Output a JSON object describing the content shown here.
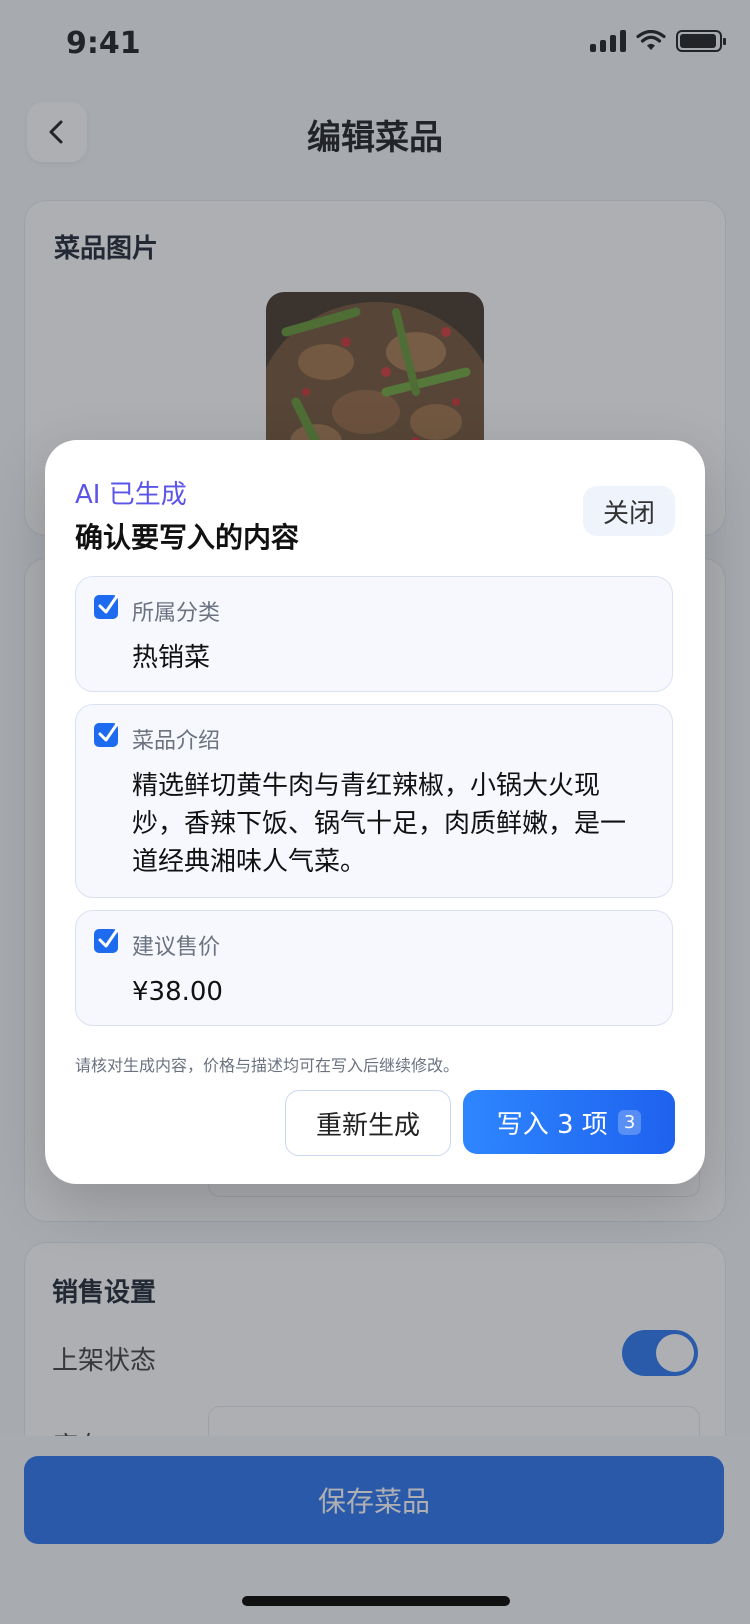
{
  "status": {
    "time": "9:41"
  },
  "header": {
    "title": "编辑菜品"
  },
  "image_card": {
    "title": "菜品图片"
  },
  "sales_card": {
    "title": "销售设置",
    "listing_label": "上架状态",
    "listing_on": true,
    "stock_label_partial": "库存"
  },
  "bottom": {
    "save_label": "保存菜品"
  },
  "modal": {
    "kicker": "AI 已生成",
    "title": "确认要写入的内容",
    "close_label": "关闭",
    "items": [
      {
        "label": "所属分类",
        "value": "热销菜",
        "checked": true
      },
      {
        "label": "菜品介绍",
        "value": "精选鲜切黄牛肉与青红辣椒，小锅大火现炒，香辣下饭、锅气十足，肉质鲜嫩，是一道经典湘味人气菜。",
        "checked": true
      },
      {
        "label": "建议售价",
        "value": "¥38.00",
        "checked": true
      }
    ],
    "note": "请核对生成内容，价格与描述均可在写入后继续修改。",
    "regenerate_label": "重新生成",
    "apply_label": "写入 3 项",
    "apply_count": "3"
  },
  "colors": {
    "accent": "#1E6BF0",
    "kicker": "#5B54E8"
  }
}
